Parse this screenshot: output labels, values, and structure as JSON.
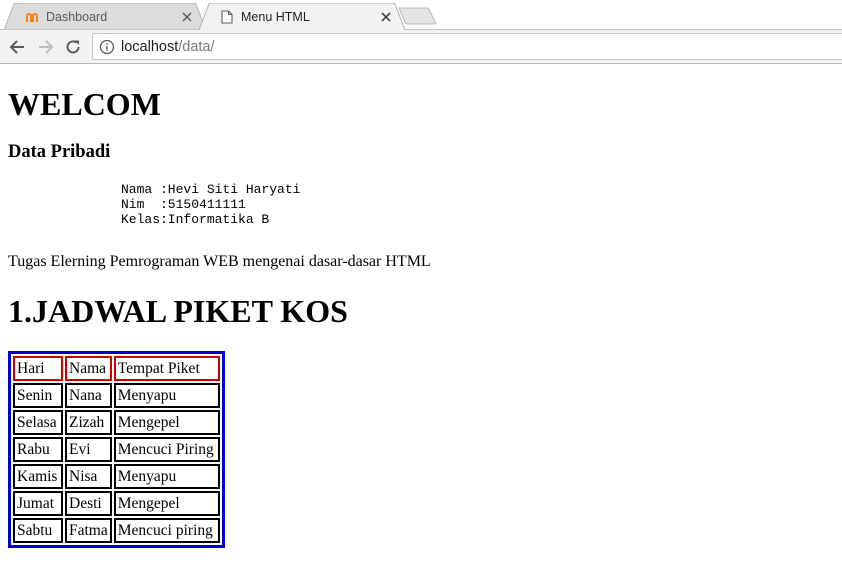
{
  "browser": {
    "tabs": [
      {
        "title": "Dashboard",
        "icon": "moodle-icon",
        "active": false
      },
      {
        "title": "Menu HTML",
        "icon": "page-icon",
        "active": true
      }
    ],
    "url_host": "localhost",
    "url_path": "/data/"
  },
  "page": {
    "welcome": "WELCOM",
    "subheading": "Data Pribadi",
    "bio": [
      "Nama :Hevi Siti Haryati",
      "Nim  :5150411111",
      "Kelas:Informatika B"
    ],
    "task": "Tugas Elerning Pemrograman WEB mengenai dasar-dasar HTML",
    "section_title": "1.JADWAL PIKET KOS",
    "table": {
      "header": [
        "Hari",
        "Nama",
        "Tempat Piket"
      ],
      "rows": [
        [
          "Senin",
          "Nana",
          "Menyapu"
        ],
        [
          "Selasa",
          "Zizah",
          "Mengepel"
        ],
        [
          "Rabu",
          "Evi",
          "Mencuci Piring"
        ],
        [
          "Kamis",
          "Nisa",
          "Menyapu"
        ],
        [
          "Jumat",
          "Desti",
          "Mengepel"
        ],
        [
          "Sabtu",
          "Fatma",
          "Mencuci piring"
        ]
      ]
    }
  },
  "colors": {
    "table_border": "#0000cc",
    "header_cell_border": "#cc0000",
    "tab_icon_orange": "#f98012"
  }
}
